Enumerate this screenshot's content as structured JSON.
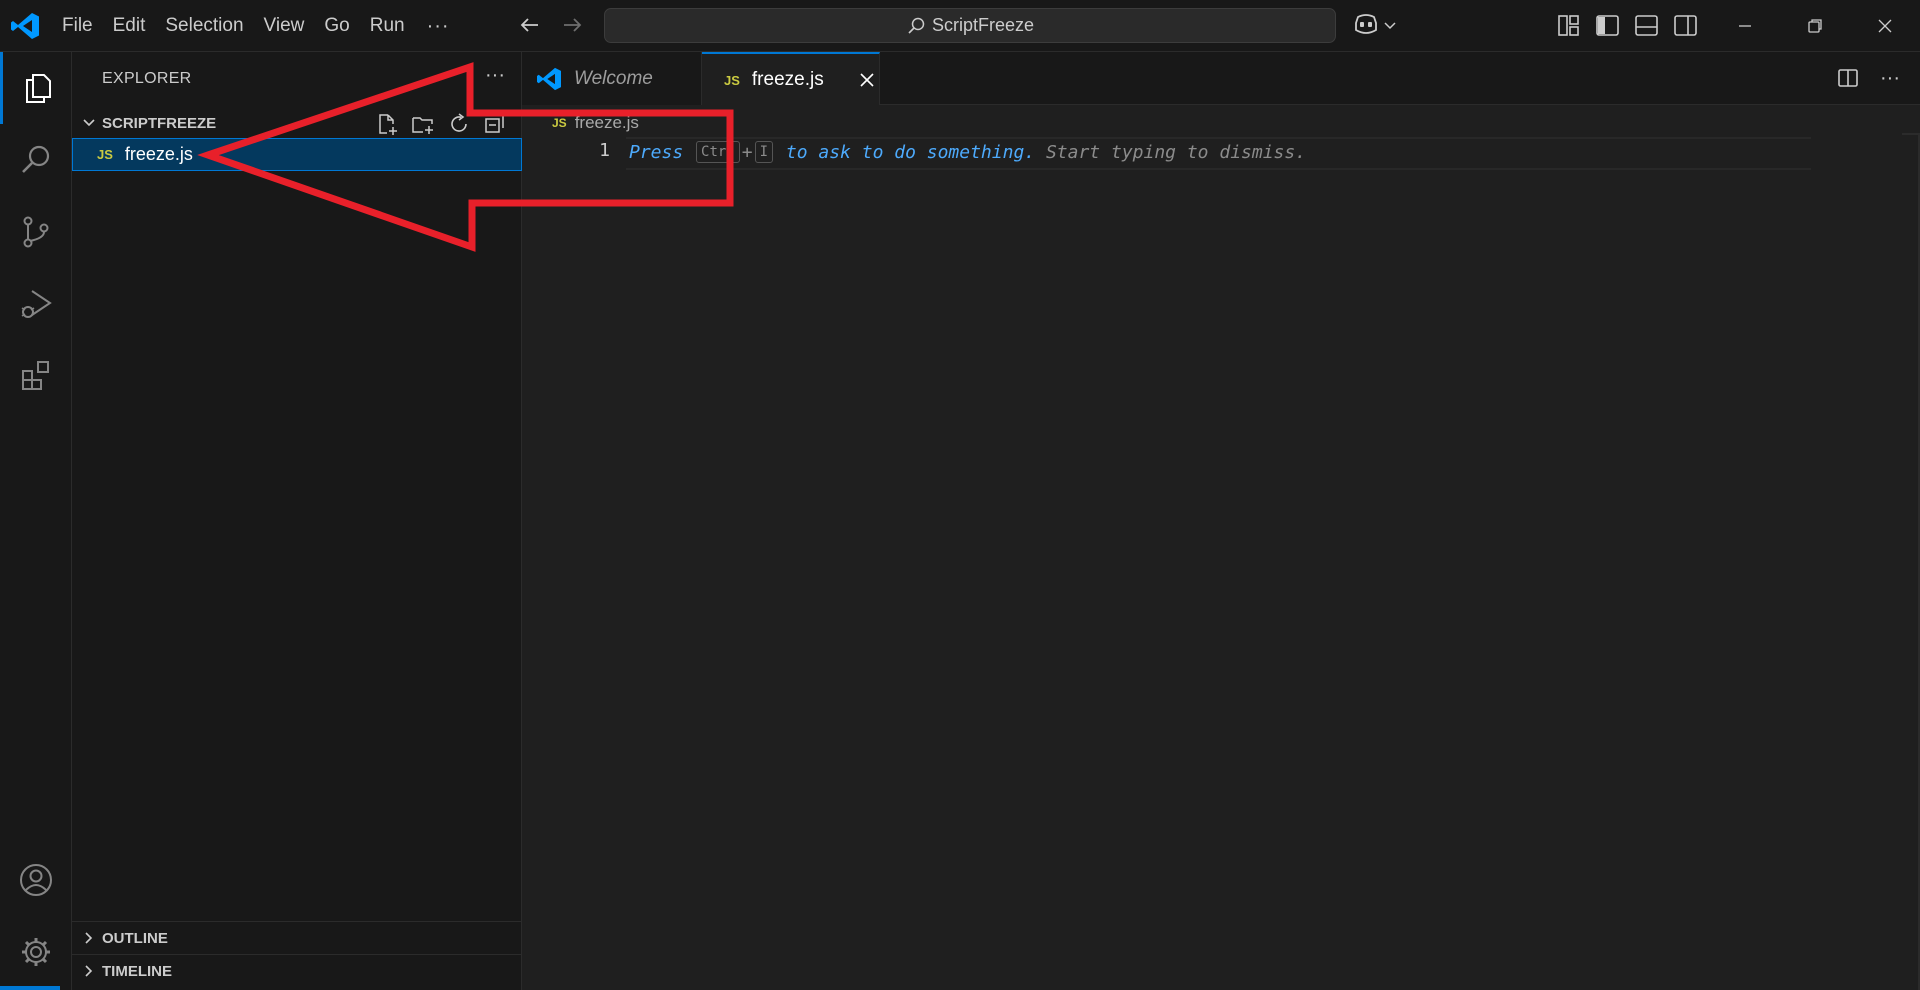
{
  "titlebar": {
    "menu": [
      "File",
      "Edit",
      "Selection",
      "View",
      "Go",
      "Run"
    ],
    "more": "···",
    "command_center": "ScriptFreeze"
  },
  "sidebar": {
    "title": "EXPLORER",
    "more": "···",
    "folder": "SCRIPTFREEZE",
    "files": [
      {
        "name": "freeze.js",
        "badge": "JS"
      }
    ],
    "sections": [
      "OUTLINE",
      "TIMELINE"
    ]
  },
  "tabs": [
    {
      "label": "Welcome"
    },
    {
      "label": "freeze.js",
      "badge": "JS"
    }
  ],
  "editor": {
    "breadcrumb": "freeze.js",
    "breadcrumb_badge": "JS",
    "line_number": "1",
    "hint_press": "Press",
    "hint_key1": "Ctrl",
    "hint_plus": "+",
    "hint_key2": "I",
    "hint_ask": " to ask to do something.",
    "hint_dismiss": " Start typing to dismiss."
  },
  "more_actions": "···",
  "colors": {
    "accent": "#0078d4",
    "annotation": "#e8202a",
    "js": "#cbcb41",
    "link": "#4daafc"
  }
}
